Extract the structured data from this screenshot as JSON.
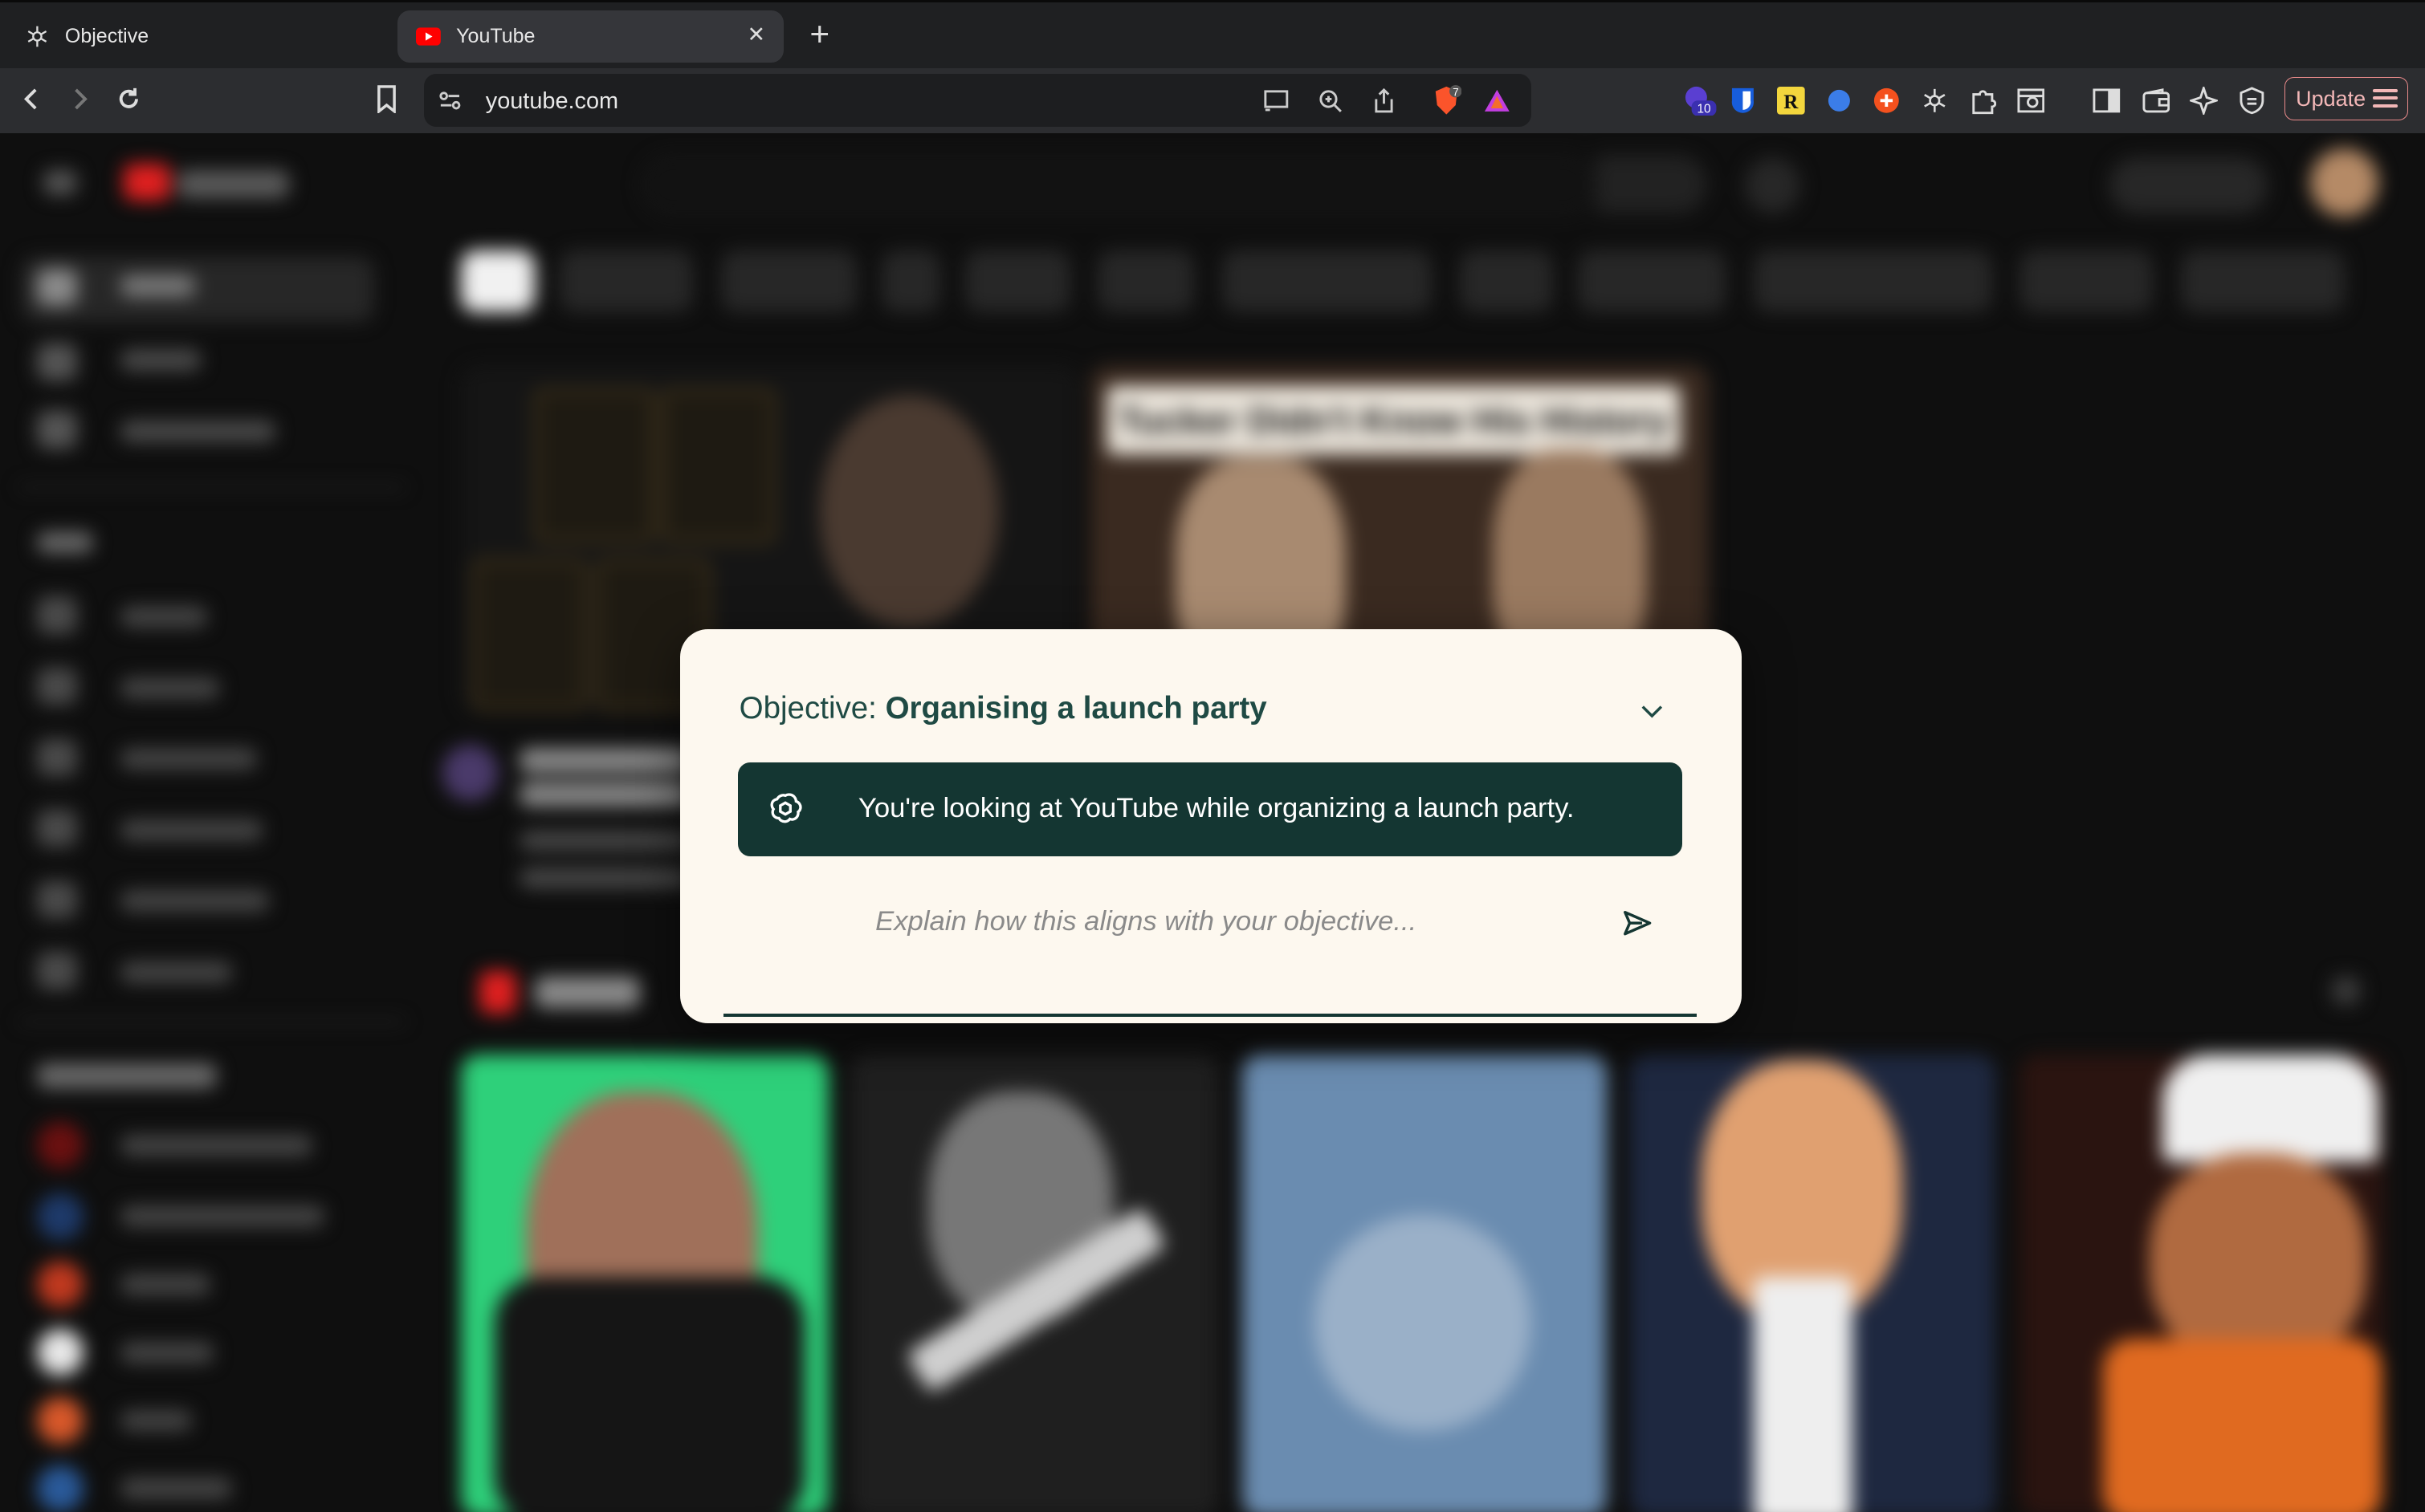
{
  "tabs": [
    {
      "label": "Objective",
      "icon": "openai-icon",
      "active": false
    },
    {
      "label": "YouTube",
      "icon": "youtube-icon",
      "active": true
    }
  ],
  "toolbar": {
    "url": "youtube.com",
    "update_label": "Update",
    "extension_badge": "10",
    "brave_badge": "7"
  },
  "background_page": {
    "video_overlay_text": "Tucker Didn't Know His History"
  },
  "modal": {
    "title_prefix": "Objective:",
    "title_value": "Organising a launch party",
    "message": "You're looking at YouTube while organizing a launch party.",
    "input_placeholder": "Explain how this aligns with your objective...",
    "colors": {
      "background": "#fdf8ef",
      "accent": "#143632",
      "title": "#1f4a44"
    }
  }
}
